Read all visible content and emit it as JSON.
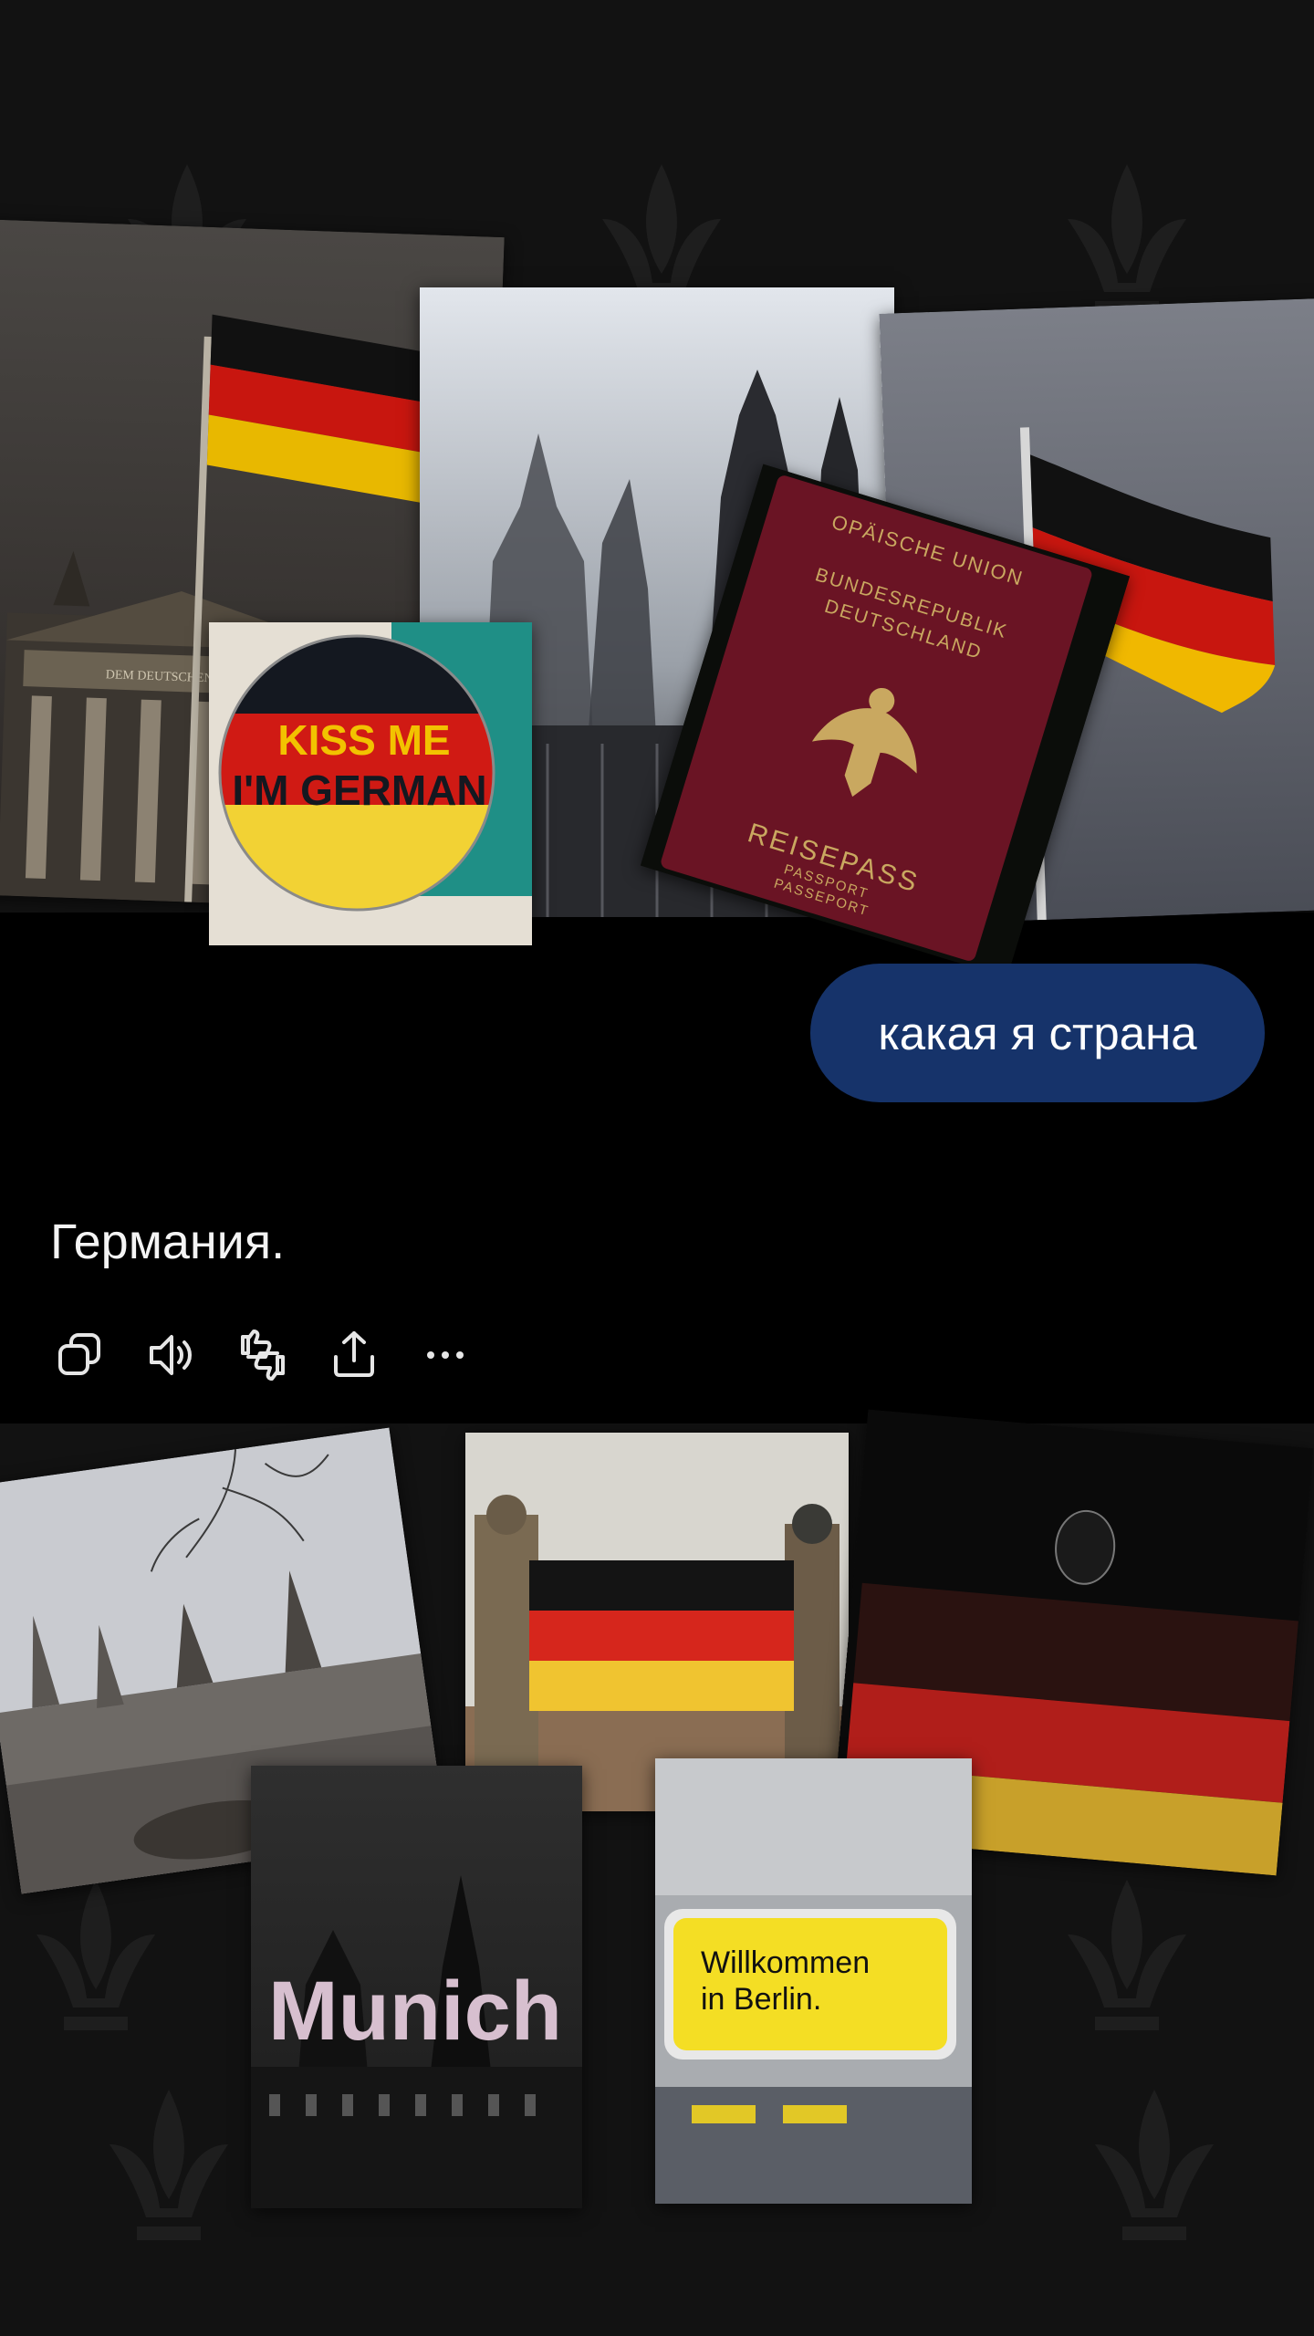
{
  "collage_top": {
    "badge_line1": "KISS ME",
    "badge_line2": "I'M GERMAN",
    "passport_union": "OPÄISCHE UNION",
    "passport_country1": "BUNDESREPUBLIK",
    "passport_country2": "DEUTSCHLAND",
    "passport_title": "REISEPASS",
    "passport_sub1": "PASSPORT",
    "passport_sub2": "PASSEPORT",
    "reichstag_inscription": "DEM DEUTSCHEN"
  },
  "chat": {
    "user_message": "какая я страна",
    "assistant_reply": "Германия."
  },
  "actions": [
    {
      "name": "copy-button",
      "icon": "copy-icon"
    },
    {
      "name": "read-aloud-button",
      "icon": "speaker-icon"
    },
    {
      "name": "feedback-button",
      "icon": "thumbs-icon"
    },
    {
      "name": "share-button",
      "icon": "share-icon"
    },
    {
      "name": "more-button",
      "icon": "more-icon"
    }
  ],
  "collage_bottom": {
    "munich_label": "Munich",
    "berlin_sign_line1": "Willkommen",
    "berlin_sign_line2": "in Berlin."
  },
  "colors": {
    "flag_black": "#111111",
    "flag_red": "#d21a15",
    "flag_gold": "#f2c200",
    "bubble": "#16336a",
    "background": "#000000"
  }
}
